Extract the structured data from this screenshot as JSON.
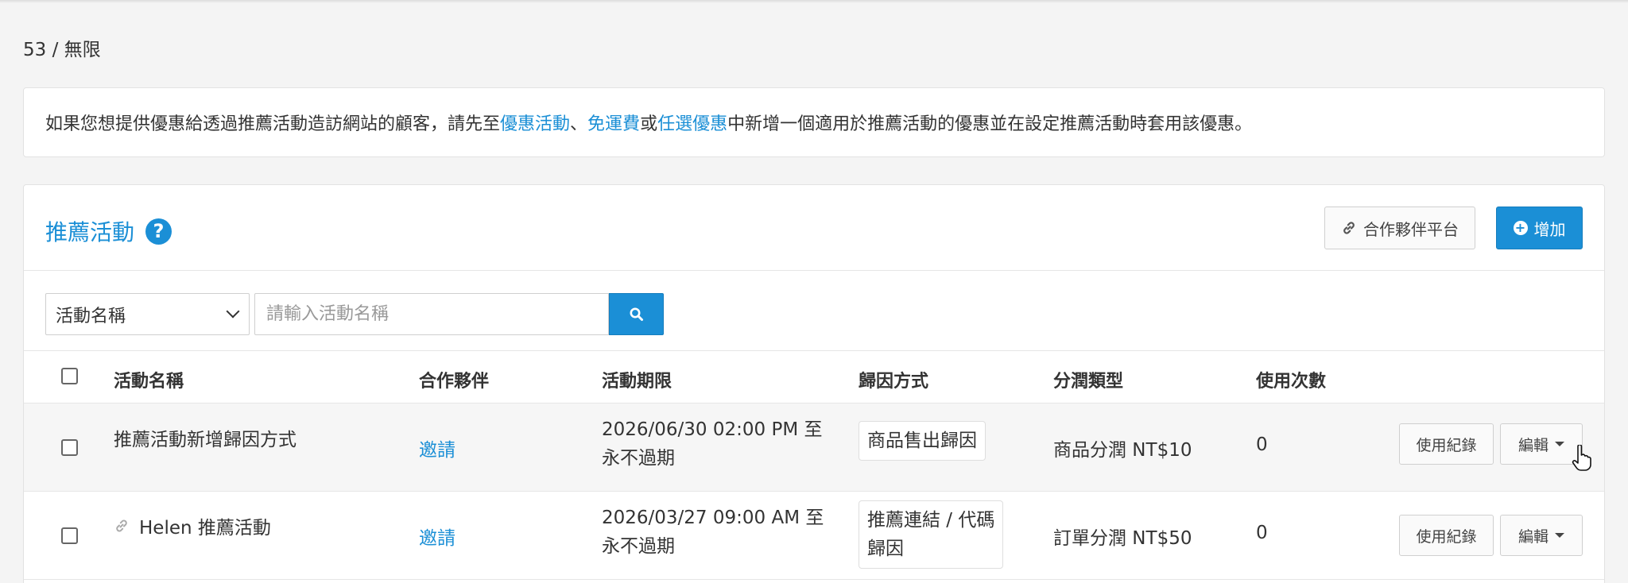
{
  "usage": {
    "counter": "53 / 無限"
  },
  "notice": {
    "text_before": "如果您想提供優惠給透過推薦活動造訪網站的顧客，請先至",
    "link_promotions": "優惠活動",
    "sep1": "、",
    "link_free_shipping": "免運費",
    "sep2": "或",
    "link_optional_discount": "任選優惠",
    "text_after": "中新增一個適用於推薦活動的優惠並在設定推薦活動時套用該優惠。"
  },
  "panel": {
    "title": "推薦活動",
    "help_icon_glyph": "?",
    "partner_platform_label": "合作夥伴平台",
    "add_label": "增加"
  },
  "filter": {
    "select_value": "活動名稱",
    "search_placeholder": "請輸入活動名稱"
  },
  "table": {
    "headers": {
      "name": "活動名稱",
      "partner": "合作夥伴",
      "period": "活動期限",
      "attribution": "歸因方式",
      "commission": "分潤類型",
      "usage": "使用次數"
    },
    "rows": [
      {
        "name": "推薦活動新增歸因方式",
        "partner": "邀請",
        "period_start": "2026/06/30 02:00 PM 至",
        "period_end": "永不過期",
        "attribution_line1": "商品售出歸因",
        "attribution_line2": "",
        "commission": "商品分潤 NT$10",
        "usage": "0",
        "log_label": "使用紀錄",
        "edit_label": "編輯"
      },
      {
        "name": "Helen 推薦活動",
        "partner": "邀請",
        "period_start": "2026/03/27 09:00 AM 至",
        "period_end": "永不過期",
        "attribution_line1": "推薦連結 / 代碼",
        "attribution_line2": "歸因",
        "commission": "訂單分潤 NT$50",
        "usage": "0",
        "log_label": "使用紀錄",
        "edit_label": "編輯"
      }
    ]
  },
  "colors": {
    "accent": "#1b8fd6",
    "background": "#f4f4f4"
  }
}
